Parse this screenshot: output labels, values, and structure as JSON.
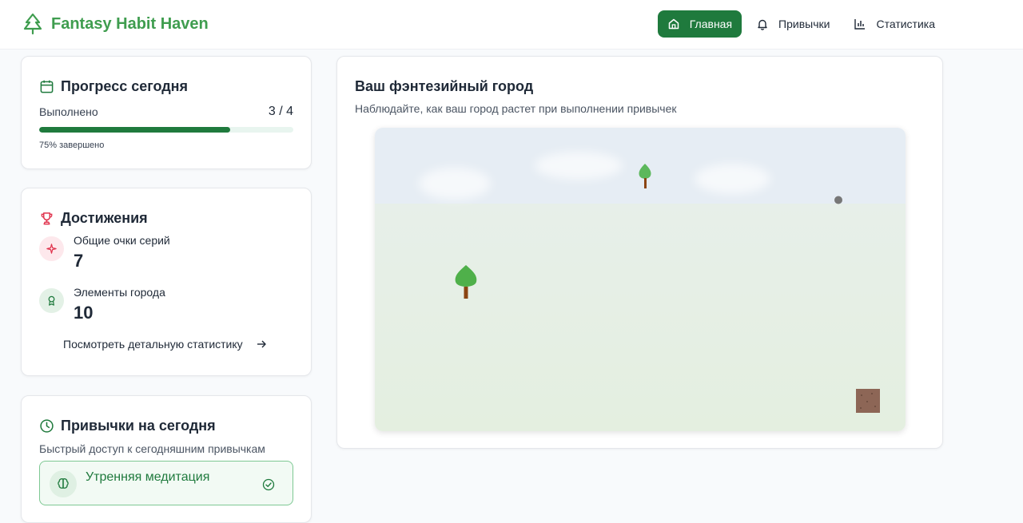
{
  "app": {
    "title": "Fantasy Habit Haven",
    "brand_color": "#3f9d4f",
    "accent_color": "#1f7a3d"
  },
  "nav": [
    {
      "label": "Главная",
      "icon": "home-icon",
      "active": true
    },
    {
      "label": "Привычки",
      "icon": "bell-icon",
      "active": false
    },
    {
      "label": "Статистика",
      "icon": "bar-chart-icon",
      "active": false
    }
  ],
  "progress": {
    "title": "Прогресс сегодня",
    "label": "Выполнено",
    "count": "3 / 4",
    "value": 0.75,
    "percent_text": "75% завершено"
  },
  "achievements": {
    "title": "Достижения",
    "streak_label": "Общие очки серий",
    "streak_value": "7",
    "city_label": "Элементы города",
    "city_value": "10",
    "link": "Посмотреть детальную статистику"
  },
  "habits": {
    "title": "Привычки на сегодня",
    "subtitle": "Быстрый доступ к сегодняшним привычкам",
    "items": [
      {
        "name": "Утренняя медитация",
        "icon": "brain-icon",
        "done": true
      }
    ]
  },
  "city": {
    "title": "Ваш фэнтезийный город",
    "subtitle": "Наблюдайте, как ваш город растет при выполнении привычек"
  }
}
